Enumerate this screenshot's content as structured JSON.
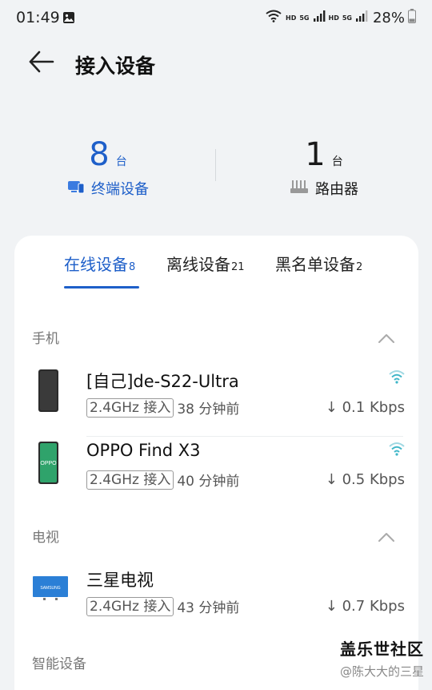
{
  "status_bar": {
    "time": "01:49",
    "net1": "HD",
    "net2_gen": "5G",
    "net2": "HD",
    "net3_gen": "5G",
    "battery": "28%"
  },
  "header": {
    "title": "接入设备"
  },
  "stats": {
    "terminals": {
      "count": "8",
      "unit": "台",
      "label": "终端设备"
    },
    "routers": {
      "count": "1",
      "unit": "台",
      "label": "路由器"
    }
  },
  "tabs": [
    {
      "label": "在线设备",
      "count": "8"
    },
    {
      "label": "离线设备",
      "count": "21"
    },
    {
      "label": "黑名单设备",
      "count": "2"
    }
  ],
  "sections": {
    "phones": {
      "title": "手机",
      "devices": [
        {
          "name": "[自己]de-S22-Ultra",
          "band": "2.4GHz 接入",
          "time": "38 分钟前",
          "speed": "0.1 Kbps"
        },
        {
          "name": "OPPO Find X3",
          "band": "2.4GHz 接入",
          "time": "40 分钟前",
          "speed": "0.5 Kbps",
          "logo": "OPPO"
        }
      ]
    },
    "tv": {
      "title": "电视",
      "devices": [
        {
          "name": "三星电视",
          "band": "2.4GHz 接入",
          "time": "43 分钟前",
          "speed": "0.7 Kbps",
          "logo": "SAMSUNG"
        }
      ]
    },
    "smart": {
      "title": "智能设备"
    }
  },
  "watermark": {
    "title": "盖乐世社区",
    "sub": "@陈大大的三星"
  },
  "colors": {
    "accent": "#1e5fc9",
    "wifi": "#3fb6c8",
    "oppo": "#2fa36b",
    "tv": "#2b7fd6"
  }
}
